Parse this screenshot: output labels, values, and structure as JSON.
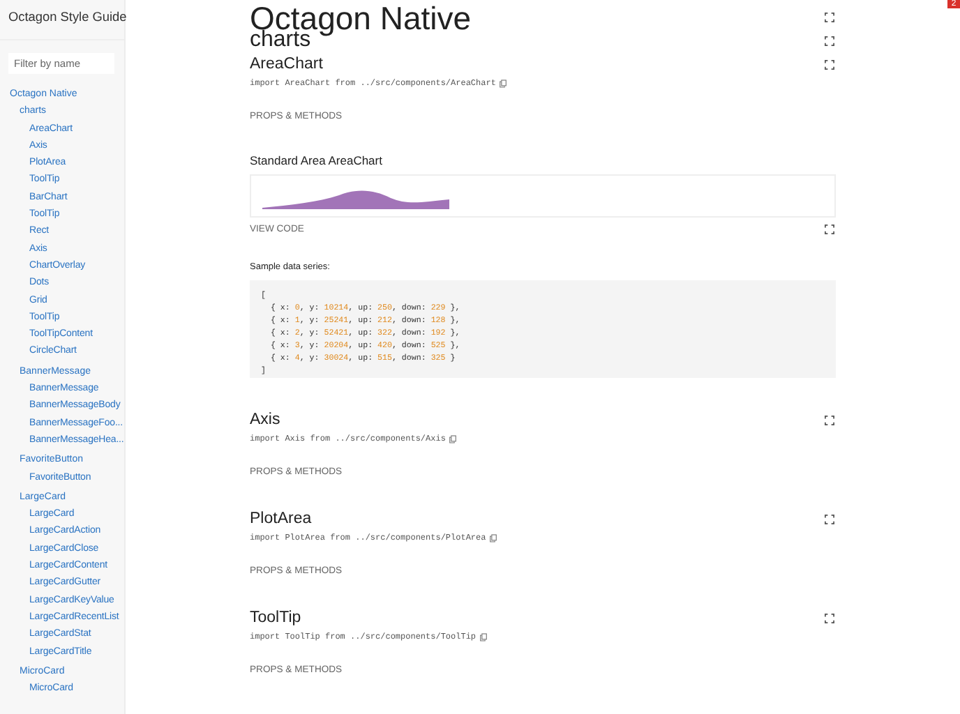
{
  "sidebar": {
    "title": "Octagon Style Guide",
    "filter": {
      "placeholder": "Filter by name"
    },
    "nav": [
      {
        "label": "Octagon Native",
        "children": [
          {
            "label": "charts",
            "children": [
              {
                "label": "AreaChart"
              },
              {
                "label": "Axis"
              },
              {
                "label": "PlotArea"
              },
              {
                "label": "ToolTip"
              },
              {
                "label": "BarChart"
              },
              {
                "label": "ToolTip"
              },
              {
                "label": "Rect"
              },
              {
                "label": "Axis"
              },
              {
                "label": "ChartOverlay"
              },
              {
                "label": "Dots"
              },
              {
                "label": "Grid"
              },
              {
                "label": "ToolTip"
              },
              {
                "label": "ToolTipContent"
              },
              {
                "label": "CircleChart"
              }
            ]
          },
          {
            "label": "BannerMessage",
            "children": [
              {
                "label": "BannerMessage"
              },
              {
                "label": "BannerMessageBody"
              },
              {
                "label": "BannerMessageFoo..."
              },
              {
                "label": "BannerMessageHea..."
              }
            ]
          },
          {
            "label": "FavoriteButton",
            "children": [
              {
                "label": "FavoriteButton"
              }
            ]
          },
          {
            "label": "LargeCard",
            "children": [
              {
                "label": "LargeCard"
              },
              {
                "label": "LargeCardAction"
              },
              {
                "label": "LargeCardClose"
              },
              {
                "label": "LargeCardContent"
              },
              {
                "label": "LargeCardGutter"
              },
              {
                "label": "LargeCardKeyValue"
              },
              {
                "label": "LargeCardRecentList"
              },
              {
                "label": "LargeCardStat"
              },
              {
                "label": "LargeCardTitle"
              }
            ]
          },
          {
            "label": "MicroCard",
            "children": [
              {
                "label": "MicroCard"
              }
            ]
          }
        ]
      }
    ]
  },
  "badge": "2",
  "header": {
    "title": "Octagon Native",
    "subtitle": "charts"
  },
  "sections": [
    {
      "title": "AreaChart",
      "import": "import AreaChart from ../src/components/AreaChart",
      "props_label": "PROPS & METHODS",
      "examples": [
        {
          "title": "Standard Area AreaChart",
          "view_code": "VIEW CODE",
          "sample_label": "Sample data series:",
          "code": [
            [
              {
                "text": "[",
                "kind": "plain"
              }
            ],
            [
              {
                "text": "  { x: ",
                "kind": "plain"
              },
              {
                "text": "0",
                "kind": "num"
              },
              {
                "text": ", y: ",
                "kind": "plain"
              },
              {
                "text": "10214",
                "kind": "num"
              },
              {
                "text": ", up: ",
                "kind": "plain"
              },
              {
                "text": "250",
                "kind": "num"
              },
              {
                "text": ", down: ",
                "kind": "plain"
              },
              {
                "text": "229",
                "kind": "num"
              },
              {
                "text": " },",
                "kind": "plain"
              }
            ],
            [
              {
                "text": "  { x: ",
                "kind": "plain"
              },
              {
                "text": "1",
                "kind": "num"
              },
              {
                "text": ", y: ",
                "kind": "plain"
              },
              {
                "text": "25241",
                "kind": "num"
              },
              {
                "text": ", up: ",
                "kind": "plain"
              },
              {
                "text": "212",
                "kind": "num"
              },
              {
                "text": ", down: ",
                "kind": "plain"
              },
              {
                "text": "128",
                "kind": "num"
              },
              {
                "text": " },",
                "kind": "plain"
              }
            ],
            [
              {
                "text": "  { x: ",
                "kind": "plain"
              },
              {
                "text": "2",
                "kind": "num"
              },
              {
                "text": ", y: ",
                "kind": "plain"
              },
              {
                "text": "52421",
                "kind": "num"
              },
              {
                "text": ", up: ",
                "kind": "plain"
              },
              {
                "text": "322",
                "kind": "num"
              },
              {
                "text": ", down: ",
                "kind": "plain"
              },
              {
                "text": "192",
                "kind": "num"
              },
              {
                "text": " },",
                "kind": "plain"
              }
            ],
            [
              {
                "text": "  { x: ",
                "kind": "plain"
              },
              {
                "text": "3",
                "kind": "num"
              },
              {
                "text": ", y: ",
                "kind": "plain"
              },
              {
                "text": "20204",
                "kind": "num"
              },
              {
                "text": ", up: ",
                "kind": "plain"
              },
              {
                "text": "420",
                "kind": "num"
              },
              {
                "text": ", down: ",
                "kind": "plain"
              },
              {
                "text": "525",
                "kind": "num"
              },
              {
                "text": " },",
                "kind": "plain"
              }
            ],
            [
              {
                "text": "  { x: ",
                "kind": "plain"
              },
              {
                "text": "4",
                "kind": "num"
              },
              {
                "text": ", y: ",
                "kind": "plain"
              },
              {
                "text": "30024",
                "kind": "num"
              },
              {
                "text": ", up: ",
                "kind": "plain"
              },
              {
                "text": "515",
                "kind": "num"
              },
              {
                "text": ", down: ",
                "kind": "plain"
              },
              {
                "text": "325",
                "kind": "num"
              },
              {
                "text": " }",
                "kind": "plain"
              }
            ],
            [
              {
                "text": "]",
                "kind": "plain"
              }
            ]
          ]
        }
      ]
    },
    {
      "title": "Axis",
      "import": "import Axis from ../src/components/Axis",
      "props_label": "PROPS & METHODS"
    },
    {
      "title": "PlotArea",
      "import": "import PlotArea from ../src/components/PlotArea",
      "props_label": "PROPS & METHODS"
    },
    {
      "title": "ToolTip",
      "import": "import ToolTip from ../src/components/ToolTip",
      "props_label": "PROPS & METHODS"
    }
  ]
}
